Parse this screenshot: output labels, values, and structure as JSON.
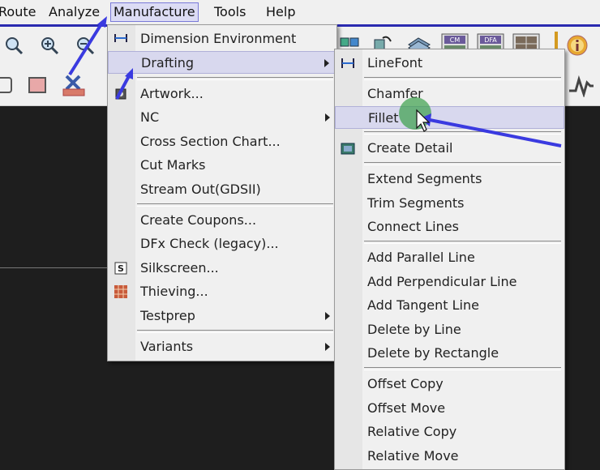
{
  "menubar": {
    "items": [
      "Route",
      "Analyze",
      "Manufacture",
      "Tools",
      "Help"
    ]
  },
  "manufacture_menu": {
    "items": [
      {
        "label": "Dimension Environment",
        "icon": "dimension-icon",
        "submenu": false
      },
      {
        "label": "Drafting",
        "icon": "",
        "submenu": true,
        "highlighted": true
      },
      {
        "label": "Artwork...",
        "icon": "artwork-icon",
        "submenu": false
      },
      {
        "label": "NC",
        "icon": "",
        "submenu": true
      },
      {
        "label": "Cross Section Chart...",
        "icon": "",
        "submenu": false
      },
      {
        "label": "Cut Marks",
        "icon": "",
        "submenu": false
      },
      {
        "label": "Stream Out(GDSII)",
        "icon": "",
        "submenu": false
      },
      {
        "label": "Create Coupons...",
        "icon": "",
        "submenu": false
      },
      {
        "label": "DFx Check (legacy)...",
        "icon": "",
        "submenu": false
      },
      {
        "label": "Silkscreen...",
        "icon": "silkscreen-icon",
        "submenu": false
      },
      {
        "label": "Thieving...",
        "icon": "thieving-icon",
        "submenu": false
      },
      {
        "label": "Testprep",
        "icon": "",
        "submenu": true
      },
      {
        "label": "Variants",
        "icon": "",
        "submenu": true
      }
    ]
  },
  "drafting_submenu": {
    "items": [
      {
        "label": "LineFont",
        "icon": "linefont-icon"
      },
      {
        "label": "Chamfer",
        "icon": ""
      },
      {
        "label": "Fillet",
        "icon": "",
        "highlighted": true
      },
      {
        "label": "Create Detail",
        "icon": "create-detail-icon"
      },
      {
        "label": "Extend Segments",
        "icon": ""
      },
      {
        "label": "Trim Segments",
        "icon": ""
      },
      {
        "label": "Connect Lines",
        "icon": ""
      },
      {
        "label": "Add Parallel Line",
        "icon": ""
      },
      {
        "label": "Add Perpendicular Line",
        "icon": ""
      },
      {
        "label": "Add Tangent Line",
        "icon": ""
      },
      {
        "label": "Delete by Line",
        "icon": ""
      },
      {
        "label": "Delete by Rectangle",
        "icon": ""
      },
      {
        "label": "Offset Copy",
        "icon": ""
      },
      {
        "label": "Offset Move",
        "icon": ""
      },
      {
        "label": "Relative Copy",
        "icon": ""
      },
      {
        "label": "Relative Move",
        "icon": ""
      }
    ]
  },
  "toolbar": {
    "icons": [
      "zoom-fit-icon",
      "zoom-in-icon",
      "zoom-out-icon",
      "layers-icon",
      "component-icon",
      "stack-icon",
      "cm-icon",
      "dfa-icon",
      "grid-icon",
      "info-icon",
      "square-icon",
      "rect-icon",
      "delete-icon",
      "route-wave-icon"
    ],
    "badges": {
      "cm": "CM",
      "dfa": "DFA"
    }
  },
  "colors": {
    "menu_bg": "#f0f0f0",
    "highlight": "#d8d8ee",
    "annotation_arrow": "#3a3ae0",
    "cursor_circle": "#3aa04a",
    "canvas": "#1e1e1e"
  }
}
